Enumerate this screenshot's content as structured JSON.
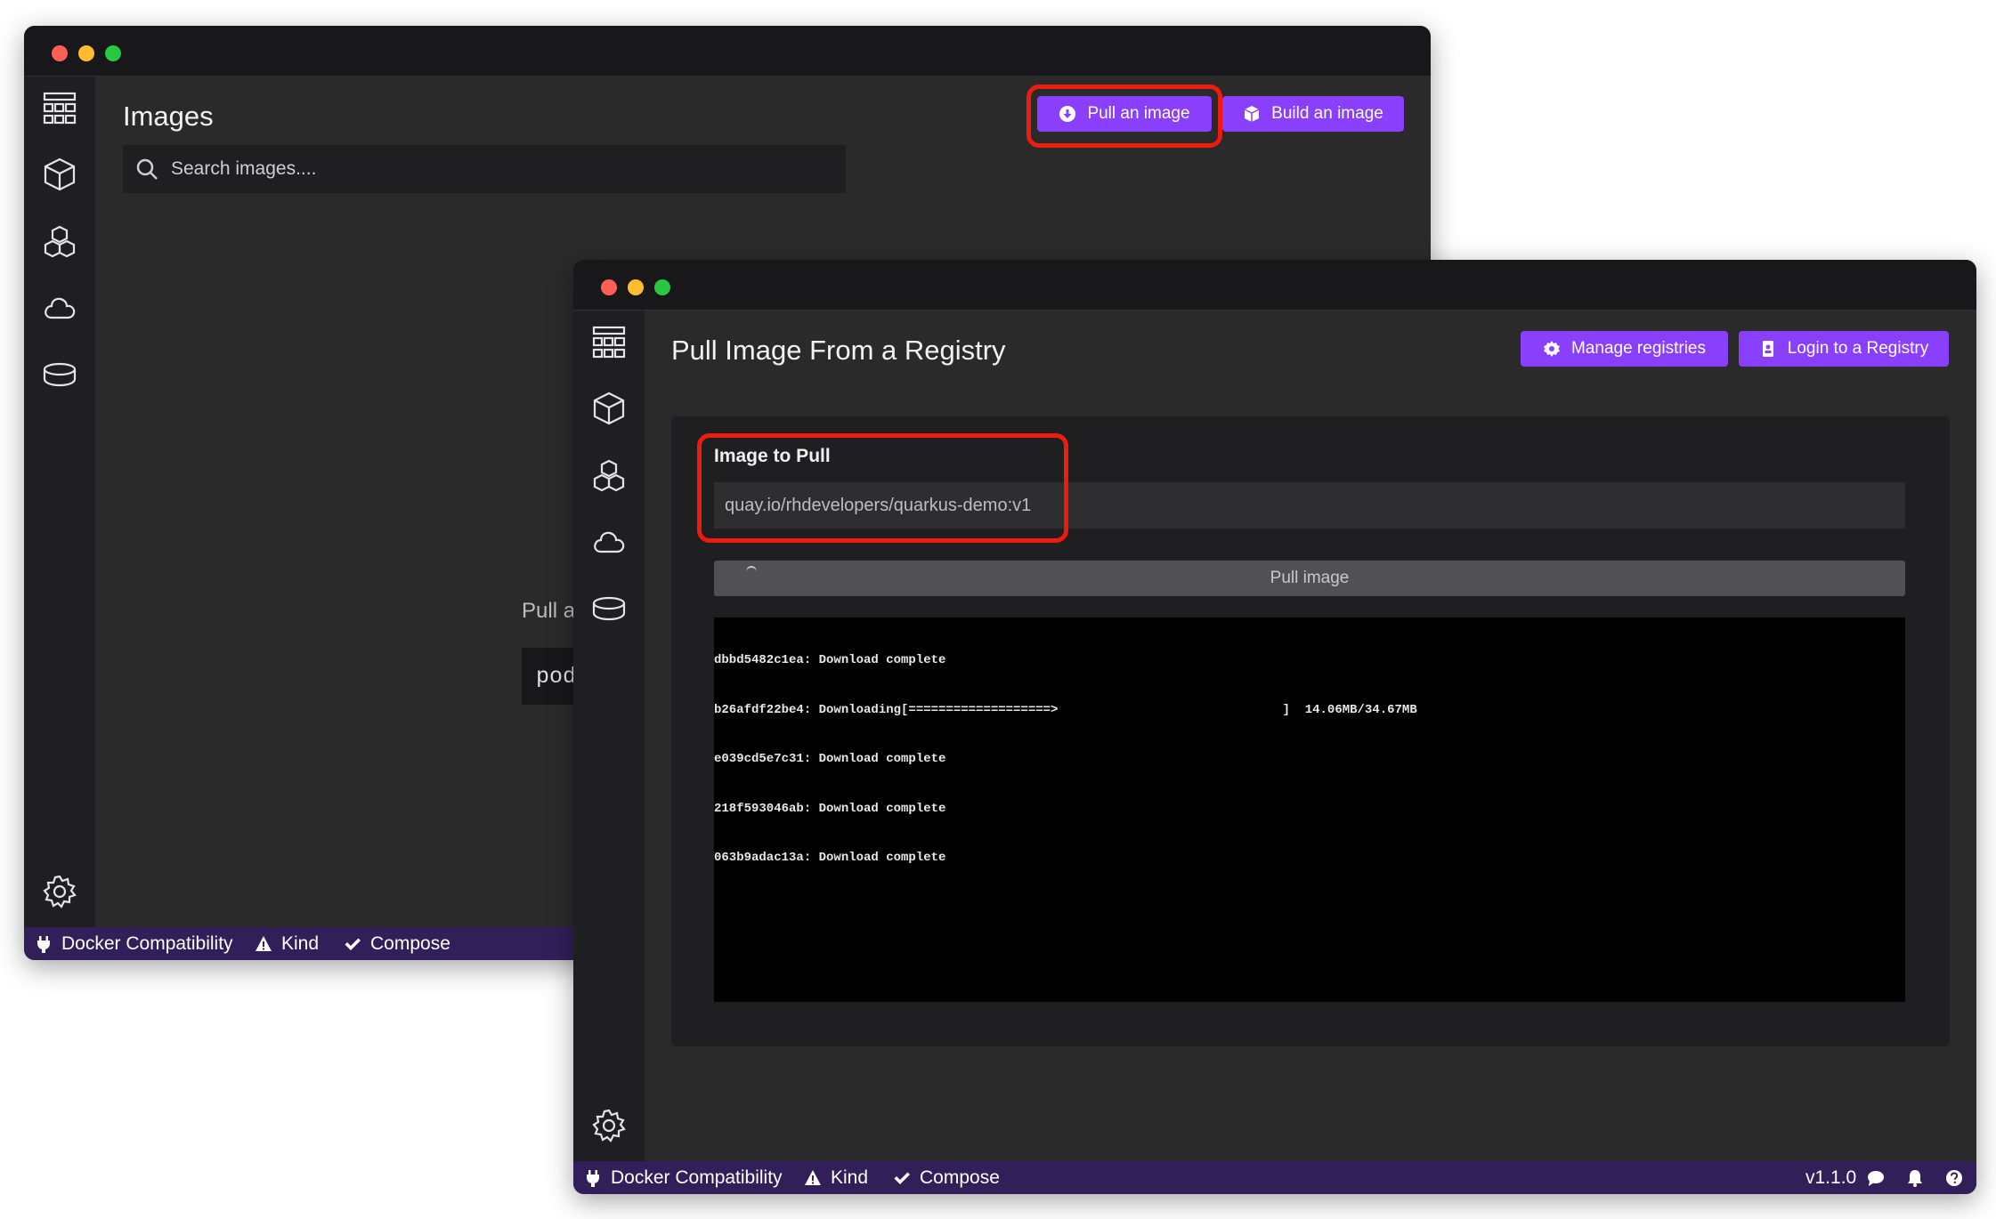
{
  "back_window": {
    "page_title": "Images",
    "search": {
      "placeholder": "Search images...."
    },
    "buttons": {
      "pull": "Pull an image",
      "build": "Build an image"
    },
    "empty_state": {
      "text_partial": "Pull a",
      "command_partial": "pod"
    },
    "status": {
      "docker": "Docker Compatibility",
      "kind": "Kind",
      "compose": "Compose"
    }
  },
  "front_window": {
    "page_title": "Pull Image From a Registry",
    "buttons": {
      "manage": "Manage registries",
      "login": "Login to a Registry",
      "pull_image": "Pull image"
    },
    "form": {
      "label": "Image to Pull",
      "value": "quay.io/rhdevelopers/quarkus-demo:v1"
    },
    "terminal": {
      "lines": [
        "dbbd5482c1ea: Download complete",
        "b26afdf22be4: Downloading[===================>                              ]  14.06MB/34.67MB",
        "e039cd5e7c31: Download complete",
        "218f593046ab: Download complete",
        "063b9adac13a: Download complete"
      ]
    },
    "status": {
      "docker": "Docker Compatibility",
      "kind": "Kind",
      "compose": "Compose",
      "version": "v1.1.0"
    }
  },
  "sidebar_icons": [
    "dashboard-icon",
    "container-icon",
    "pods-icon",
    "images-cloud-icon",
    "volumes-icon",
    "settings-icon"
  ],
  "colors": {
    "accent": "#8a3ffc",
    "highlight": "#ee1c0e",
    "statusbar": "#311f5a",
    "background": "#2a2a2b"
  }
}
